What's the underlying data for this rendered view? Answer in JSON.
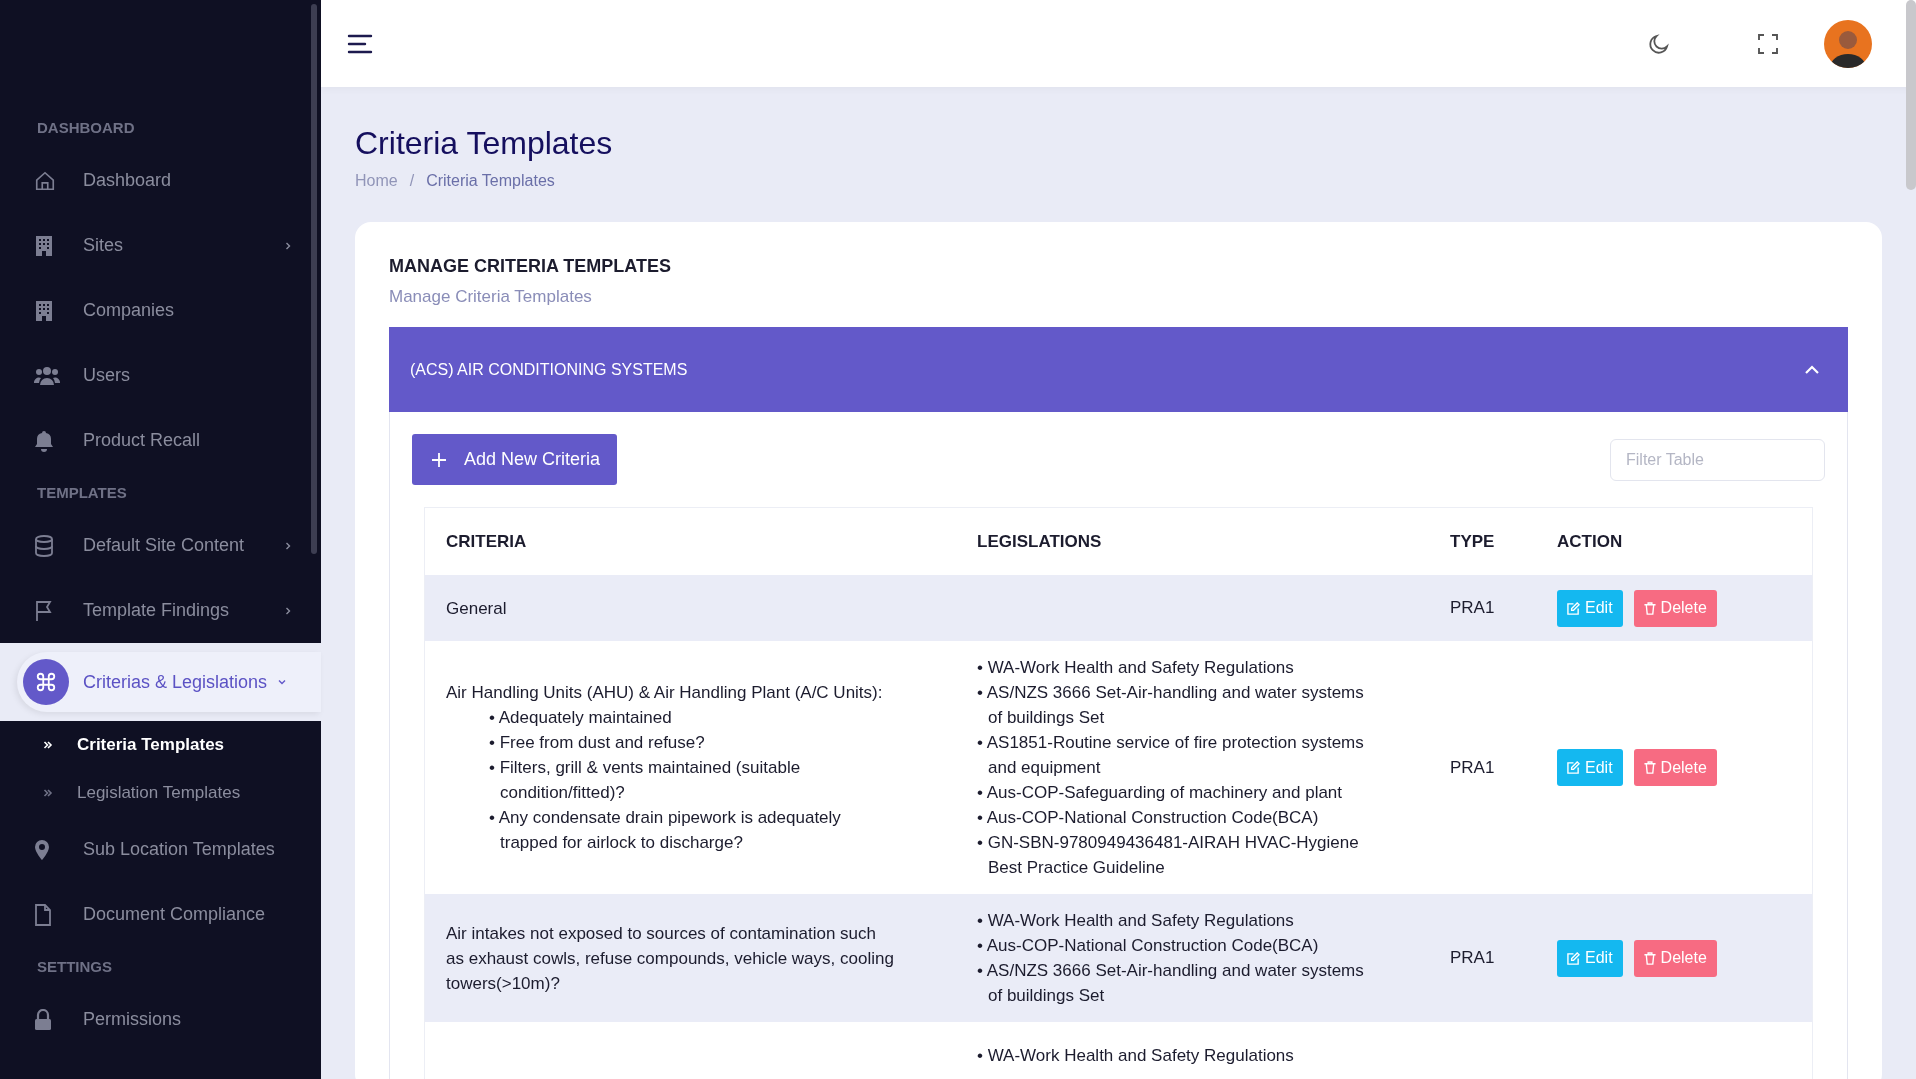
{
  "sidebar": [
    {
      "kind": "section",
      "label": "DASHBOARD"
    },
    {
      "kind": "item",
      "label": "Dashboard",
      "selected": false
    },
    {
      "kind": "item",
      "label": "Sites",
      "selected": false,
      "expanded": false
    },
    {
      "kind": "item",
      "label": "Companies",
      "selected": false
    },
    {
      "kind": "item",
      "label": "Users",
      "selected": false
    },
    {
      "kind": "item",
      "label": "Product Recall",
      "selected": false
    },
    {
      "kind": "section",
      "label": "TEMPLATES"
    },
    {
      "kind": "item",
      "label": "Default Site Content",
      "selected": false,
      "expanded": false
    },
    {
      "kind": "item",
      "label": "Template Findings",
      "selected": false,
      "expanded": false
    },
    {
      "kind": "item",
      "label": "Criterias & Legislations",
      "selected": true,
      "expanded": true,
      "children": [
        {
          "label": "Criteria Templates",
          "selected": true
        },
        {
          "label": "Legislation Templates",
          "selected": false
        }
      ]
    },
    {
      "kind": "item",
      "label": "Sub Location Templates",
      "selected": false
    },
    {
      "kind": "item",
      "label": "Document Compliance",
      "selected": false
    },
    {
      "kind": "section",
      "label": "SETTINGS"
    },
    {
      "kind": "item",
      "label": "Permissions",
      "selected": false
    }
  ],
  "page": {
    "title": "Criteria Templates",
    "breadcrumb": [
      {
        "label": "Home"
      },
      {
        "label": "Criteria Templates"
      }
    ],
    "separator": "/"
  },
  "card": {
    "title": "MANAGE CRITERIA TEMPLATES",
    "subtitle": "Manage Criteria Templates",
    "accordion": {
      "title": "(ACS) AIR CONDITIONING SYSTEMS",
      "expanded": true
    },
    "add_button": "Add New Criteria",
    "filter": {
      "placeholder": "Filter Table"
    },
    "table": {
      "columns": [
        "CRITERIA",
        "LEGISLATIONS",
        "TYPE",
        "ACTION"
      ],
      "rows": [
        {
          "criteria": "General",
          "type": "PRA1",
          "actions": [
            "Edit",
            "Delete"
          ]
        },
        {
          "criteria": "Air Handling Units (AHU) & Air Handling Plant (A/C Units):",
          "points": [
            "• Adequately maintained",
            "• Free from dust and refuse?",
            "• Filters, grill & vents maintained (suitable condition/fitted)?",
            "• Any condensate drain pipework is adequately trapped for airlock to discharge?"
          ],
          "legislations": [
            "• WA-Work Health and Safety Regulations",
            "• AS/NZS 3666 Set-Air-handling and water systems of buildings Set",
            "• AS1851-Routine service of fire protection systems and equipment",
            "• Aus-COP-Safeguarding of machinery and plant",
            "• Aus-COP-National Construction Code(BCA)",
            "• GN-SBN-9780949436481-AIRAH HVAC-Hygiene Best Practice Guideline"
          ],
          "type": "PRA1",
          "actions": [
            "Edit",
            "Delete"
          ]
        },
        {
          "criteria": "Air intakes not exposed to sources of contamination such as exhaust cowls, refuse compounds, vehicle ways, cooling towers(>10m)?",
          "legislations": [
            "• WA-Work Health and Safety Regulations",
            "• Aus-COP-National Construction Code(BCA)",
            "• AS/NZS 3666 Set-Air-handling and water systems of buildings Set"
          ],
          "type": "PRA1",
          "actions": [
            "Edit",
            "Delete"
          ]
        },
        {
          "legislations": [
            "• WA-Work Health and Safety Regulations"
          ]
        }
      ]
    }
  }
}
